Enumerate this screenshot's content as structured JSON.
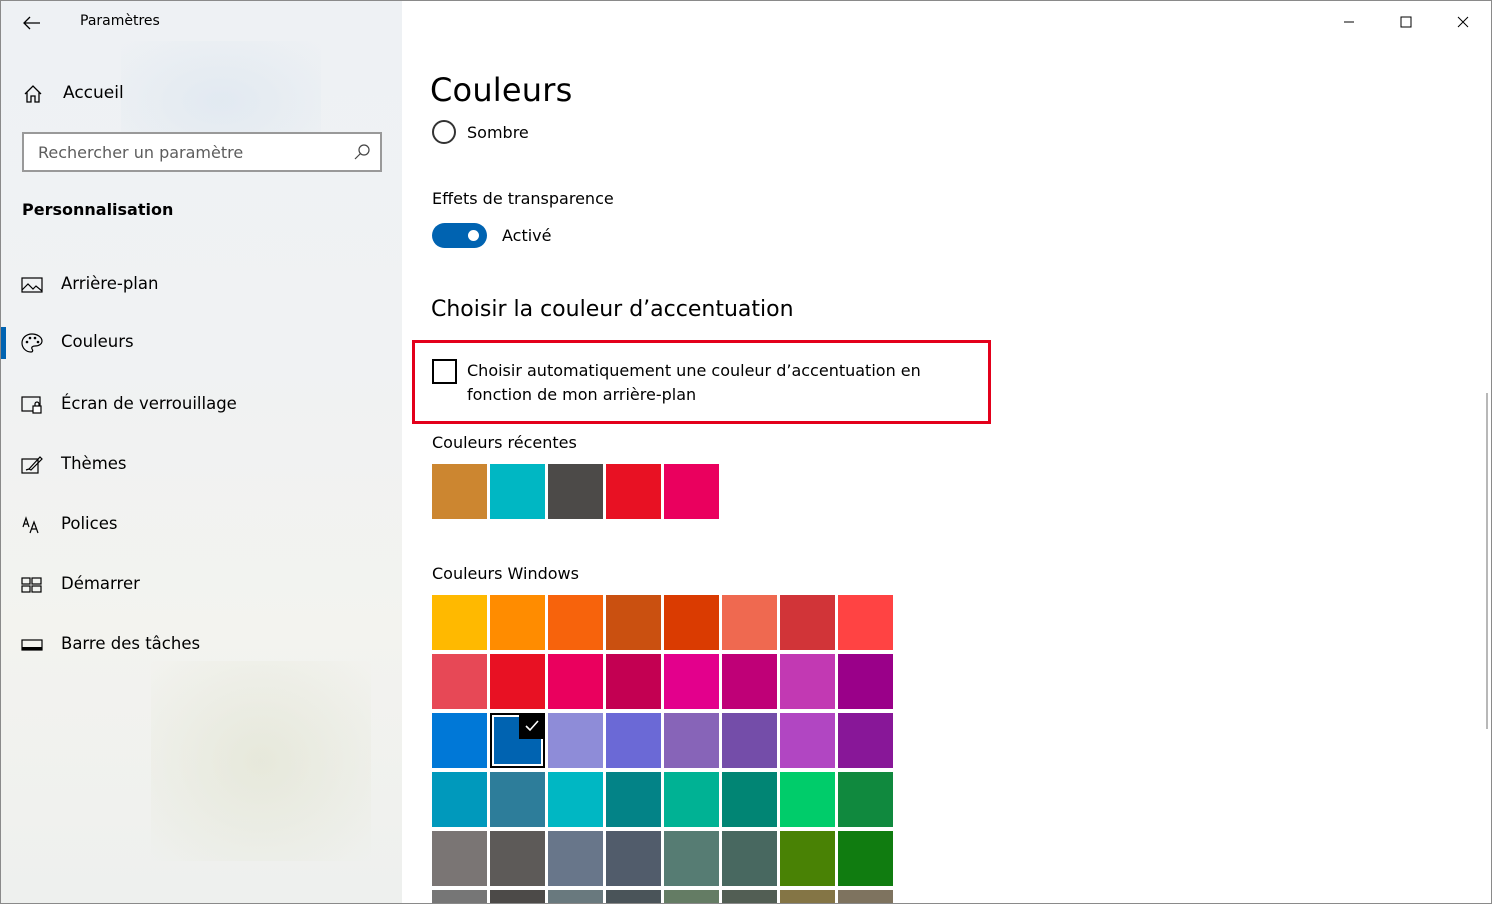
{
  "window": {
    "title": "Paramètres"
  },
  "sidebar": {
    "home_label": "Accueil",
    "search_placeholder": "Rechercher un paramètre",
    "section_title": "Personnalisation",
    "items": [
      {
        "label": "Arrière-plan",
        "icon": "picture-icon"
      },
      {
        "label": "Couleurs",
        "icon": "palette-icon",
        "active": true
      },
      {
        "label": "Écran de verrouillage",
        "icon": "lock-screen-icon"
      },
      {
        "label": "Thèmes",
        "icon": "themes-icon"
      },
      {
        "label": "Polices",
        "icon": "fonts-icon"
      },
      {
        "label": "Démarrer",
        "icon": "start-icon"
      },
      {
        "label": "Barre des tâches",
        "icon": "taskbar-icon"
      }
    ],
    "accent_color": "#0063b1"
  },
  "main": {
    "title": "Couleurs",
    "mode_option": "Sombre",
    "transparency_label": "Effets de transparence",
    "transparency_state": "Activé",
    "accent_section_title": "Choisir la couleur d’accentuation",
    "auto_accent_label": "Choisir automatiquement une couleur d’accentuation en fonction de mon arrière-plan",
    "recent_colors_label": "Couleurs récentes",
    "recent_colors": [
      "#cc8630",
      "#00b7c3",
      "#4c4a48",
      "#e81123",
      "#ea005e"
    ],
    "windows_colors_label": "Couleurs Windows",
    "windows_colors": [
      "#ffb900",
      "#ff8c00",
      "#f7630c",
      "#ca5010",
      "#da3b01",
      "#ef6950",
      "#d13438",
      "#ff4343",
      "#e74856",
      "#e81123",
      "#ea005e",
      "#c30052",
      "#e3008c",
      "#bf0077",
      "#c239b3",
      "#9a0089",
      "#0078d7",
      "#0063b1",
      "#8e8cd8",
      "#6b69d6",
      "#8764b8",
      "#744da9",
      "#b146c2",
      "#881798",
      "#0099bc",
      "#2d7d9a",
      "#00b7c3",
      "#038387",
      "#00b294",
      "#018574",
      "#00cc6a",
      "#10893e",
      "#7a7574",
      "#5d5a58",
      "#68768a",
      "#515c6b",
      "#567c73",
      "#486860",
      "#498205",
      "#107c10",
      "#767676",
      "#4c4a48",
      "#69797e",
      "#4a5459",
      "#647c64",
      "#525e54",
      "#847545",
      "#7e735f"
    ],
    "selected_windows_color_index": 17,
    "highlight_color": "#e3001b"
  }
}
